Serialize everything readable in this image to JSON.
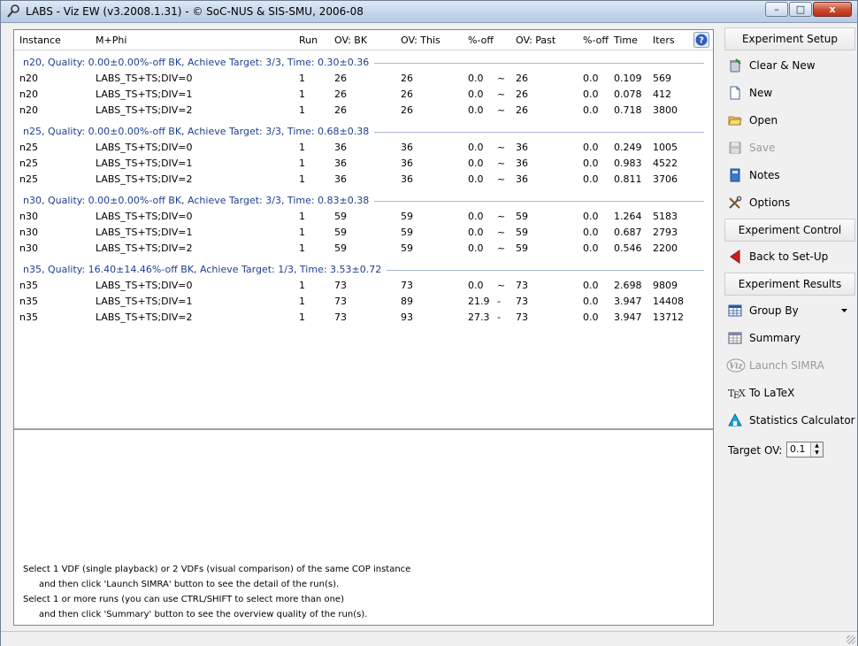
{
  "window": {
    "title": "LABS - Viz EW (v3.2008.1.31) - © SoC-NUS & SIS-SMU, 2006-08",
    "minimize_glyph": "–",
    "maximize_glyph": "□",
    "close_glyph": "x"
  },
  "grid": {
    "columns": {
      "instance": "Instance",
      "mphi": "M+Phi",
      "run": "Run",
      "ov_bk": "OV: BK",
      "ov_this": "OV: This",
      "pct_off": "%-off",
      "ov_past": "OV: Past",
      "pct_off2": "%-off",
      "time": "Time",
      "iters": "Iters"
    },
    "groups": [
      {
        "label": "n20, Quality: 0.00±0.00%-off BK, Achieve Target: 3/3, Time: 0.30±0.36",
        "rows": [
          {
            "instance": "n20",
            "mphi": "LABS_TS+TS;DIV=0",
            "run": "1",
            "ov_bk": "26",
            "ov_this": "26",
            "pct_off": "0.0",
            "sym": "~",
            "ov_past": "26",
            "pct_off2": "0.0",
            "time": "0.109",
            "iters": "569"
          },
          {
            "instance": "n20",
            "mphi": "LABS_TS+TS;DIV=1",
            "run": "1",
            "ov_bk": "26",
            "ov_this": "26",
            "pct_off": "0.0",
            "sym": "~",
            "ov_past": "26",
            "pct_off2": "0.0",
            "time": "0.078",
            "iters": "412"
          },
          {
            "instance": "n20",
            "mphi": "LABS_TS+TS;DIV=2",
            "run": "1",
            "ov_bk": "26",
            "ov_this": "26",
            "pct_off": "0.0",
            "sym": "~",
            "ov_past": "26",
            "pct_off2": "0.0",
            "time": "0.718",
            "iters": "3800"
          }
        ]
      },
      {
        "label": "n25, Quality: 0.00±0.00%-off BK, Achieve Target: 3/3, Time: 0.68±0.38",
        "rows": [
          {
            "instance": "n25",
            "mphi": "LABS_TS+TS;DIV=0",
            "run": "1",
            "ov_bk": "36",
            "ov_this": "36",
            "pct_off": "0.0",
            "sym": "~",
            "ov_past": "36",
            "pct_off2": "0.0",
            "time": "0.249",
            "iters": "1005"
          },
          {
            "instance": "n25",
            "mphi": "LABS_TS+TS;DIV=1",
            "run": "1",
            "ov_bk": "36",
            "ov_this": "36",
            "pct_off": "0.0",
            "sym": "~",
            "ov_past": "36",
            "pct_off2": "0.0",
            "time": "0.983",
            "iters": "4522"
          },
          {
            "instance": "n25",
            "mphi": "LABS_TS+TS;DIV=2",
            "run": "1",
            "ov_bk": "36",
            "ov_this": "36",
            "pct_off": "0.0",
            "sym": "~",
            "ov_past": "36",
            "pct_off2": "0.0",
            "time": "0.811",
            "iters": "3706"
          }
        ]
      },
      {
        "label": "n30, Quality: 0.00±0.00%-off BK, Achieve Target: 3/3, Time: 0.83±0.38",
        "rows": [
          {
            "instance": "n30",
            "mphi": "LABS_TS+TS;DIV=0",
            "run": "1",
            "ov_bk": "59",
            "ov_this": "59",
            "pct_off": "0.0",
            "sym": "~",
            "ov_past": "59",
            "pct_off2": "0.0",
            "time": "1.264",
            "iters": "5183"
          },
          {
            "instance": "n30",
            "mphi": "LABS_TS+TS;DIV=1",
            "run": "1",
            "ov_bk": "59",
            "ov_this": "59",
            "pct_off": "0.0",
            "sym": "~",
            "ov_past": "59",
            "pct_off2": "0.0",
            "time": "0.687",
            "iters": "2793"
          },
          {
            "instance": "n30",
            "mphi": "LABS_TS+TS;DIV=2",
            "run": "1",
            "ov_bk": "59",
            "ov_this": "59",
            "pct_off": "0.0",
            "sym": "~",
            "ov_past": "59",
            "pct_off2": "0.0",
            "time": "0.546",
            "iters": "2200"
          }
        ]
      },
      {
        "label": "n35, Quality: 16.40±14.46%-off BK, Achieve Target: 1/3, Time: 3.53±0.72",
        "rows": [
          {
            "instance": "n35",
            "mphi": "LABS_TS+TS;DIV=0",
            "run": "1",
            "ov_bk": "73",
            "ov_this": "73",
            "pct_off": "0.0",
            "sym": "~",
            "ov_past": "73",
            "pct_off2": "0.0",
            "time": "2.698",
            "iters": "9809"
          },
          {
            "instance": "n35",
            "mphi": "LABS_TS+TS;DIV=1",
            "run": "1",
            "ov_bk": "73",
            "ov_this": "89",
            "pct_off": "21.9",
            "sym": "-",
            "ov_past": "73",
            "pct_off2": "0.0",
            "time": "3.947",
            "iters": "14408"
          },
          {
            "instance": "n35",
            "mphi": "LABS_TS+TS;DIV=2",
            "run": "1",
            "ov_bk": "73",
            "ov_this": "93",
            "pct_off": "27.3",
            "sym": "-",
            "ov_past": "73",
            "pct_off2": "0.0",
            "time": "3.947",
            "iters": "13712"
          }
        ]
      }
    ]
  },
  "info": {
    "line1": "Select 1 VDF (single playback) or 2 VDFs (visual comparison) of the same COP instance",
    "line2": "and then click 'Launch SIMRA' button to see the detail of the run(s).",
    "line3": "Select 1 or more runs (you can use CTRL/SHIFT to select more than one)",
    "line4": "and then click 'Summary' button to see the overview quality of the run(s)."
  },
  "sidebar": {
    "setup_header": "Experiment Setup",
    "clear_new": "Clear & New",
    "new": "New",
    "open": "Open",
    "save": "Save",
    "notes": "Notes",
    "options": "Options",
    "control_header": "Experiment Control",
    "back_setup": "Back to Set-Up",
    "results_header": "Experiment Results",
    "group_by": "Group By",
    "summary": "Summary",
    "launch_simra": "Launch SIMRA",
    "to_latex": "To LaTeX",
    "stats_calc": "Statistics Calculator",
    "target_ov_label": "Target OV:",
    "target_ov_value": "0.1",
    "icon_names": [
      "clear-new-icon",
      "new-document-icon",
      "open-folder-icon",
      "save-disk-icon",
      "notes-book-icon",
      "options-tools-icon",
      "back-arrow-icon",
      "group-by-grid-icon",
      "summary-table-icon",
      "viz-logo-icon",
      "tex-logo-icon",
      "statistics-calculator-icon"
    ]
  },
  "colors": {
    "group_text": "#1f3f8e",
    "back_arrow": "#d01c1c",
    "stats_icon": "#1aa6d8"
  }
}
